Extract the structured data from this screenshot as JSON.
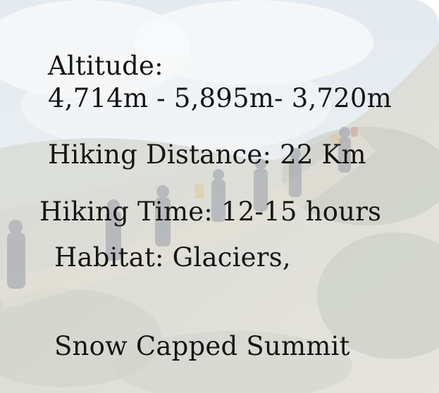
{
  "info": {
    "altitude_label": "Altitude:",
    "altitude_value": "4,714m - 5,895m- 3,720m",
    "hiking_distance": "Hiking Distance: 22 Km",
    "hiking_time": "Hiking Time: 12-15 hours",
    "habitat_line1": "Habitat: Glaciers,",
    "habitat_line2": "Snow Capped Summit"
  },
  "colors": {
    "text": "#151515",
    "sky": "#dfe7ee",
    "slope": "#c9cabf",
    "vegetation": "#9aa58f"
  }
}
